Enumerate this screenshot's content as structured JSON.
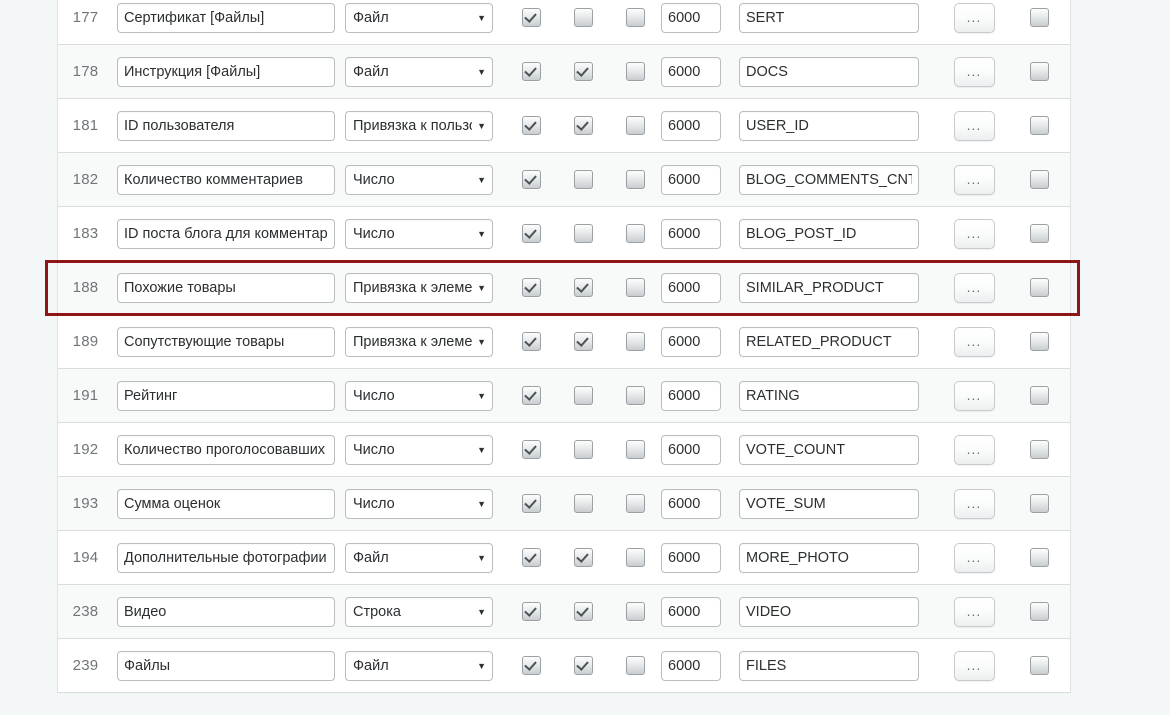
{
  "grid": {
    "select_arrow_glyph": "▼",
    "dots_label": "...",
    "highlighted_row_id": "188",
    "highlight_color": "#8e1417",
    "rows": [
      {
        "id": "177",
        "name": "Сертификат [Файлы]",
        "type": "Файл",
        "cb1": true,
        "cb2": false,
        "cb3": false,
        "sort": "6000",
        "code": "SERT",
        "dots": "...",
        "cb_last": false
      },
      {
        "id": "178",
        "name": "Инструкция [Файлы]",
        "type": "Файл",
        "cb1": true,
        "cb2": true,
        "cb3": false,
        "sort": "6000",
        "code": "DOCS",
        "dots": "...",
        "cb_last": false
      },
      {
        "id": "181",
        "name": "ID пользователя",
        "type": "Привязка к пользователю",
        "cb1": true,
        "cb2": true,
        "cb3": false,
        "sort": "6000",
        "code": "USER_ID",
        "dots": "...",
        "cb_last": false
      },
      {
        "id": "182",
        "name": "Количество комментариев",
        "type": "Число",
        "cb1": true,
        "cb2": false,
        "cb3": false,
        "sort": "6000",
        "code": "BLOG_COMMENTS_CNT",
        "dots": "...",
        "cb_last": false
      },
      {
        "id": "183",
        "name": "ID поста блога для комментариев",
        "type": "Число",
        "cb1": true,
        "cb2": false,
        "cb3": false,
        "sort": "6000",
        "code": "BLOG_POST_ID",
        "dots": "...",
        "cb_last": false
      },
      {
        "id": "188",
        "name": "Похожие товары",
        "type": "Привязка к элементам",
        "cb1": true,
        "cb2": true,
        "cb3": false,
        "sort": "6000",
        "code": "SIMILAR_PRODUCT",
        "dots": "...",
        "cb_last": false
      },
      {
        "id": "189",
        "name": "Сопутствующие товары",
        "type": "Привязка к элементам",
        "cb1": true,
        "cb2": true,
        "cb3": false,
        "sort": "6000",
        "code": "RELATED_PRODUCT",
        "dots": "...",
        "cb_last": false
      },
      {
        "id": "191",
        "name": "Рейтинг",
        "type": "Число",
        "cb1": true,
        "cb2": false,
        "cb3": false,
        "sort": "6000",
        "code": "RATING",
        "dots": "...",
        "cb_last": false
      },
      {
        "id": "192",
        "name": "Количество проголосовавших",
        "type": "Число",
        "cb1": true,
        "cb2": false,
        "cb3": false,
        "sort": "6000",
        "code": "VOTE_COUNT",
        "dots": "...",
        "cb_last": false
      },
      {
        "id": "193",
        "name": "Сумма оценок",
        "type": "Число",
        "cb1": true,
        "cb2": false,
        "cb3": false,
        "sort": "6000",
        "code": "VOTE_SUM",
        "dots": "...",
        "cb_last": false
      },
      {
        "id": "194",
        "name": "Дополнительные фотографии",
        "type": "Файл",
        "cb1": true,
        "cb2": true,
        "cb3": false,
        "sort": "6000",
        "code": "MORE_PHOTO",
        "dots": "...",
        "cb_last": false
      },
      {
        "id": "238",
        "name": "Видео",
        "type": "Строка",
        "cb1": true,
        "cb2": true,
        "cb3": false,
        "sort": "6000",
        "code": "VIDEO",
        "dots": "...",
        "cb_last": false
      },
      {
        "id": "239",
        "name": "Файлы",
        "type": "Файл",
        "cb1": true,
        "cb2": true,
        "cb3": false,
        "sort": "6000",
        "code": "FILES",
        "dots": "...",
        "cb_last": false
      }
    ]
  }
}
